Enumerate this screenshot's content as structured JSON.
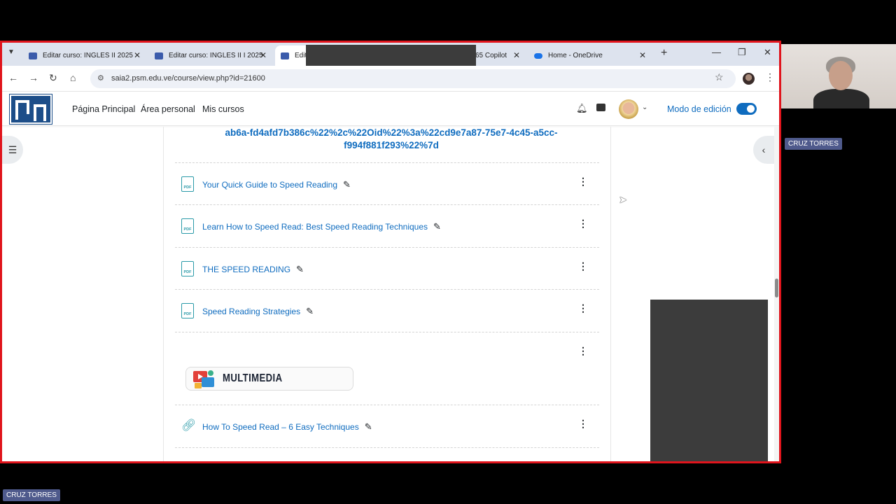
{
  "browser": {
    "tabs": [
      {
        "label": "Editar curso: INGLES II 2025"
      },
      {
        "label": "Editar curso: INGLES II I 2025"
      },
      {
        "label": "Editi"
      },
      {
        "label": "65 Copilot"
      },
      {
        "label": "Home - OneDrive"
      }
    ],
    "url": "saia2.psm.edu.ve/course/view.php?id=21600"
  },
  "header": {
    "nav": [
      "Página Principal",
      "Área personal",
      "Mis cursos"
    ],
    "edit_mode_label": "Modo de edición",
    "edit_mode_on": true
  },
  "course": {
    "long_link_line1": "ab6a-fd4afd7b386c%22%2c%22Oid%22%3a%22cd9e7a87-75e7-4c45-a5cc-",
    "long_link_line2": "f994f881f293%22%7d",
    "activities": [
      {
        "type": "pdf",
        "title": "Your Quick Guide to Speed Reading"
      },
      {
        "type": "pdf",
        "title": "Learn How to Speed Read: Best Speed Reading Techniques"
      },
      {
        "type": "pdf",
        "title": "THE SPEED READING"
      },
      {
        "type": "pdf",
        "title": "Speed Reading Strategies"
      }
    ],
    "banner_label": "MULTIMEDIA",
    "url_activity": {
      "type": "url",
      "title": "How To Speed Read – 6 Easy Techniques"
    }
  },
  "participants": {
    "cam_name": "CRUZ TORRES",
    "bottom_name": "CRUZ TORRES"
  }
}
